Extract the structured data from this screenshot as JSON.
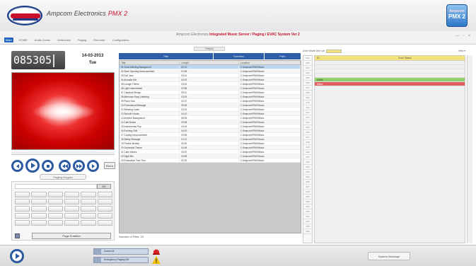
{
  "header": {
    "brand": "Ampcom Electronics",
    "product": "PMX 2",
    "app_icon_top": "Ampcom",
    "app_icon_bottom": "PMX 2"
  },
  "tabbar": {
    "title_prefix": "Ampcom Electronics",
    "title_highlight": "Integrated Music Server / Paging / EVAC System Ver 2",
    "tabs": [
      "Main",
      "HOME",
      "Audio Zones",
      "Schedules",
      "Paging",
      "Recorder",
      "Configuration"
    ],
    "window_controls": "— ▫ ×"
  },
  "left": {
    "clock": "085305",
    "date": "14-03-2013",
    "day": "Tue",
    "mode_button": "Run ▸",
    "keypad_label": "Paging Keypad",
    "keypad_go": "OK",
    "page_ack": "Page Enabled"
  },
  "center": {
    "tab_label": "Playlist",
    "col_headers": [
      "Title",
      "Duration",
      "Path"
    ],
    "list_headers": [
      "Title",
      "Length",
      "Location"
    ],
    "rows": [
      [
        "01 Good Morning Background",
        "02:12",
        "C:\\Ampcom\\PMX\\Music"
      ],
      [
        "02 Store Opening Announcement",
        "01:05",
        "C:\\Ampcom\\PMX\\Music"
      ],
      [
        "03 Soft Jazz",
        "03:41",
        "C:\\Ampcom\\PMX\\Music"
      ],
      [
        "04 Acoustic Mix",
        "04:02",
        "C:\\Ampcom\\PMX\\Music"
      ],
      [
        "05 Lounge Theme",
        "03:15",
        "C:\\Ampcom\\PMX\\Music"
      ],
      [
        "06 Light Instrumental",
        "02:58",
        "C:\\Ampcom\\PMX\\Music"
      ],
      [
        "07 Classical Strings",
        "05:10",
        "C:\\Ampcom\\PMX\\Music"
      ],
      [
        "08 Afternoon Easy Listening",
        "03:33",
        "C:\\Ampcom\\PMX\\Music"
      ],
      [
        "09 Piano Solo",
        "02:47",
        "C:\\Ampcom\\PMX\\Music"
      ],
      [
        "10 Promotional Message",
        "00:45",
        "C:\\Ampcom\\PMX\\Music"
      ],
      [
        "11 Relaxing Guitar",
        "03:22",
        "C:\\Ampcom\\PMX\\Music"
      ],
      [
        "12 Smooth Vocals",
        "04:10",
        "C:\\Ampcom\\PMX\\Music"
      ],
      [
        "13 Ambient Background",
        "06:05",
        "C:\\Ampcom\\PMX\\Music"
      ],
      [
        "14 Cafe Bossa",
        "03:08",
        "C:\\Ampcom\\PMX\\Music"
      ],
      [
        "15 Instrumental Pop",
        "03:44",
        "C:\\Ampcom\\PMX\\Music"
      ],
      [
        "16 Evening Chill",
        "04:20",
        "C:\\Ampcom\\PMX\\Music"
      ],
      [
        "17 Closing Announcement",
        "00:55",
        "C:\\Ampcom\\PMX\\Music"
      ],
      [
        "18 Safety Message",
        "01:12",
        "C:\\Ampcom\\PMX\\Music"
      ],
      [
        "19 Festive Medley",
        "05:30",
        "C:\\Ampcom\\PMX\\Music"
      ],
      [
        "20 Orchestral Theme",
        "04:48",
        "C:\\Ampcom\\PMX\\Music"
      ],
      [
        "21 Calm Waves",
        "03:57",
        "C:\\Ampcom\\PMX\\Music"
      ],
      [
        "22 Night Mix",
        "04:05",
        "C:\\Ampcom\\PMX\\Music"
      ],
      [
        "23 Evacuation Tone Test",
        "00:30",
        "C:\\Ampcom\\PMX\\Music"
      ]
    ],
    "footer": "Number of Files: 23"
  },
  "right": {
    "toolbar_left": "Zone Mode  Gen  Vol",
    "toolbar_right": "View ▾",
    "grid_headers": [
      "ID",
      "Zone Status"
    ],
    "zone_ids": [
      "Z01",
      "Z02",
      "Z03",
      "Z04",
      "Z05",
      "Z06",
      "Z07",
      "Z08",
      "Z09",
      "Z10",
      "Z11",
      "Z12",
      "Z13",
      "Z14",
      "Z15",
      "Z16",
      "Z17",
      "Z18",
      "Z19",
      "Z20",
      "Z21",
      "Z22",
      "Z23",
      "Z24",
      "Z25",
      "Z26",
      "Z27",
      "Z28",
      "Z29",
      "Z30",
      "Z31",
      "Z32",
      "Z33",
      "Z34",
      "Z35",
      "Z36"
    ],
    "green_row": "Active",
    "red_row": "Alarm"
  },
  "bottom": {
    "zone_box_1": "Zones All",
    "zone_box_2": "Emergency Paging Off",
    "system_message": "System Message"
  }
}
